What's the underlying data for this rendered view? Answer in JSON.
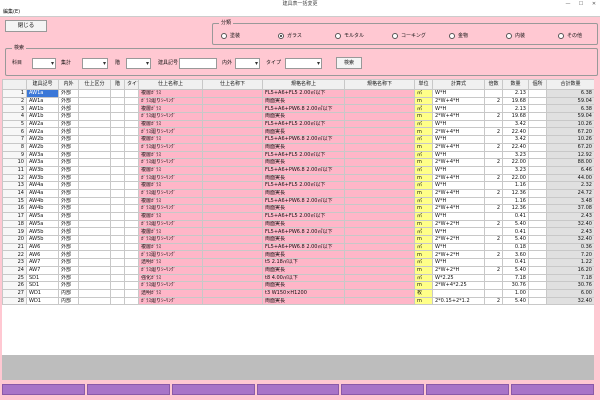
{
  "window": {
    "title": "建具表一括変更",
    "minimize": "—",
    "maximize": "☐",
    "close": "✕"
  },
  "menu": {
    "edit": "編集(E)"
  },
  "close_button": "閉じる",
  "category_group": {
    "title": "分類",
    "options": [
      "塗装",
      "ガラス",
      "モルタル",
      "コーキング",
      "金物",
      "内装",
      "その他"
    ],
    "selected": "ガラス"
  },
  "search_group": {
    "title": "検索",
    "labels": {
      "subject": "科目",
      "aggregate": "集計",
      "floor": "階",
      "fixture_no": "建具記号",
      "in_out": "内外",
      "type": "タイプ"
    },
    "search_button": "検索"
  },
  "table": {
    "headers": [
      "",
      "建具記号",
      "内外",
      "仕上区分",
      "階",
      "タイプ",
      "仕上名称上",
      "仕上名称下",
      "規格名称上",
      "規格名称下",
      "単位",
      "計算式",
      "倍数",
      "数量",
      "個所",
      "合計数量"
    ],
    "rows": [
      [
        "1",
        "AW1a",
        "外部",
        "",
        "",
        "",
        "複層ｶﾞﾗｽ",
        "",
        "FL5+A6+FL5 2.00㎡以下",
        "",
        "㎡",
        "W*H",
        "",
        "2.13",
        "",
        "6.38"
      ],
      [
        "2",
        "AW1a",
        "外部",
        "",
        "",
        "",
        "ｶﾞﾗｽ廻りｼｰﾘﾝｸﾞ",
        "",
        "両面実長",
        "",
        "m",
        "2*W+4*H",
        "2",
        "19.68",
        "",
        "59.04"
      ],
      [
        "3",
        "AW1b",
        "外部",
        "",
        "",
        "",
        "複層ｶﾞﾗｽ",
        "",
        "FL5+A6+PW6.8 2.00㎡以下",
        "",
        "㎡",
        "W*H",
        "",
        "2.13",
        "",
        "6.38"
      ],
      [
        "4",
        "AW1b",
        "外部",
        "",
        "",
        "",
        "ｶﾞﾗｽ廻りｼｰﾘﾝｸﾞ",
        "",
        "両面実長",
        "",
        "m",
        "2*W+4*H",
        "2",
        "19.68",
        "",
        "59.04"
      ],
      [
        "5",
        "AW2a",
        "外部",
        "",
        "",
        "",
        "複層ｶﾞﾗｽ",
        "",
        "FL5+A6+FL5 2.00㎡以下",
        "",
        "㎡",
        "W*H",
        "",
        "3.42",
        "",
        "10.26"
      ],
      [
        "6",
        "AW2a",
        "外部",
        "",
        "",
        "",
        "ｶﾞﾗｽ廻りｼｰﾘﾝｸﾞ",
        "",
        "両面実長",
        "",
        "m",
        "2*W+4*H",
        "2",
        "22.40",
        "",
        "67.20"
      ],
      [
        "7",
        "AW2b",
        "外部",
        "",
        "",
        "",
        "複層ｶﾞﾗｽ",
        "",
        "FL5+A6+PW6.8 2.00㎡以下",
        "",
        "㎡",
        "W*H",
        "",
        "3.42",
        "",
        "10.26"
      ],
      [
        "8",
        "AW2b",
        "外部",
        "",
        "",
        "",
        "ｶﾞﾗｽ廻りｼｰﾘﾝｸﾞ",
        "",
        "両面実長",
        "",
        "m",
        "2*W+4*H",
        "2",
        "22.40",
        "",
        "67.20"
      ],
      [
        "9",
        "AW3a",
        "外部",
        "",
        "",
        "",
        "複層ｶﾞﾗｽ",
        "",
        "FL5+A6+FL5 2.00㎡以下",
        "",
        "㎡",
        "W*H",
        "",
        "3.23",
        "",
        "12.92"
      ],
      [
        "10",
        "AW3a",
        "外部",
        "",
        "",
        "",
        "ｶﾞﾗｽ廻りｼｰﾘﾝｸﾞ",
        "",
        "両面実長",
        "",
        "m",
        "2*W+4*H",
        "2",
        "22.00",
        "",
        "88.00"
      ],
      [
        "11",
        "AW3b",
        "外部",
        "",
        "",
        "",
        "複層ｶﾞﾗｽ",
        "",
        "FL5+A6+PW6.8 2.00㎡以下",
        "",
        "㎡",
        "W*H",
        "",
        "3.23",
        "",
        "6.46"
      ],
      [
        "12",
        "AW3b",
        "外部",
        "",
        "",
        "",
        "ｶﾞﾗｽ廻りｼｰﾘﾝｸﾞ",
        "",
        "両面実長",
        "",
        "m",
        "2*W+4*H",
        "2",
        "22.00",
        "",
        "44.00"
      ],
      [
        "13",
        "AW4a",
        "外部",
        "",
        "",
        "",
        "複層ｶﾞﾗｽ",
        "",
        "FL5+A6+FL5 2.00㎡以下",
        "",
        "㎡",
        "W*H",
        "",
        "1.16",
        "",
        "2.32"
      ],
      [
        "14",
        "AW4a",
        "外部",
        "",
        "",
        "",
        "ｶﾞﾗｽ廻りｼｰﾘﾝｸﾞ",
        "",
        "両面実長",
        "",
        "m",
        "2*W+4*H",
        "2",
        "12.36",
        "",
        "24.72"
      ],
      [
        "15",
        "AW4b",
        "外部",
        "",
        "",
        "",
        "複層ｶﾞﾗｽ",
        "",
        "FL5+A6+PW6.8 2.00㎡以下",
        "",
        "㎡",
        "W*H",
        "",
        "1.16",
        "",
        "3.48"
      ],
      [
        "16",
        "AW4b",
        "外部",
        "",
        "",
        "",
        "ｶﾞﾗｽ廻りｼｰﾘﾝｸﾞ",
        "",
        "両面実長",
        "",
        "m",
        "2*W+4*H",
        "2",
        "12.36",
        "",
        "37.08"
      ],
      [
        "17",
        "AW5a",
        "外部",
        "",
        "",
        "",
        "複層ｶﾞﾗｽ",
        "",
        "FL5+A6+FL5 2.00㎡以下",
        "",
        "㎡",
        "W*H",
        "",
        "0.41",
        "",
        "2.43"
      ],
      [
        "18",
        "AW5a",
        "外部",
        "",
        "",
        "",
        "ｶﾞﾗｽ廻りｼｰﾘﾝｸﾞ",
        "",
        "両面実長",
        "",
        "m",
        "2*W+2*H",
        "2",
        "5.40",
        "",
        "32.40"
      ],
      [
        "19",
        "AW5b",
        "外部",
        "",
        "",
        "",
        "複層ｶﾞﾗｽ",
        "",
        "FL5+A6+PW6.8 2.00㎡以下",
        "",
        "㎡",
        "W*H",
        "",
        "0.41",
        "",
        "2.43"
      ],
      [
        "20",
        "AW5b",
        "外部",
        "",
        "",
        "",
        "ｶﾞﾗｽ廻りｼｰﾘﾝｸﾞ",
        "",
        "両面実長",
        "",
        "m",
        "2*W+2*H",
        "2",
        "5.40",
        "",
        "32.40"
      ],
      [
        "21",
        "AW6",
        "外部",
        "",
        "",
        "",
        "複層ｶﾞﾗｽ",
        "",
        "FL5+A6+PW6.8 2.00㎡以下",
        "",
        "㎡",
        "W*H",
        "",
        "0.18",
        "",
        "0.36"
      ],
      [
        "22",
        "AW6",
        "外部",
        "",
        "",
        "",
        "ｶﾞﾗｽ廻りｼｰﾘﾝｸﾞ",
        "",
        "両面実長",
        "",
        "m",
        "2*W+2*H",
        "2",
        "3.60",
        "",
        "7.20"
      ],
      [
        "23",
        "AW7",
        "外部",
        "",
        "",
        "",
        "透明ｶﾞﾗｽ",
        "",
        "t5 2.18㎡以下",
        "",
        "㎡",
        "W*H",
        "",
        "0.41",
        "",
        "1.22"
      ],
      [
        "24",
        "AW7",
        "外部",
        "",
        "",
        "",
        "ｶﾞﾗｽ廻りｼｰﾘﾝｸﾞ",
        "",
        "両面実長",
        "",
        "m",
        "2*W+2*H",
        "2",
        "5.40",
        "",
        "16.20"
      ],
      [
        "25",
        "SD1",
        "外部",
        "",
        "",
        "",
        "強化ｶﾞﾗｽ",
        "",
        "t8 4.00㎡以下",
        "",
        "㎡",
        "W*2.25",
        "",
        "7.18",
        "",
        "7.18"
      ],
      [
        "26",
        "SD1",
        "外部",
        "",
        "",
        "",
        "ｶﾞﾗｽ廻りｼｰﾘﾝｸﾞ",
        "",
        "両面実長",
        "",
        "m",
        "2*W+4*2.25",
        "",
        "30.76",
        "",
        "30.76"
      ],
      [
        "27",
        "WD1",
        "内部",
        "",
        "",
        "",
        "透明ｶﾞﾗｽ",
        "",
        "t3 W150×H1200",
        "",
        "枚",
        "",
        "",
        "1.00",
        "",
        "6.00"
      ],
      [
        "28",
        "WD1",
        "内部",
        "",
        "",
        "",
        "ｶﾞﾗｽ廻りｼｰﾘﾝｸﾞ",
        "",
        "両面実長",
        "",
        "m",
        "2*0.15+2*1.2",
        "2",
        "5.40",
        "",
        "32.40"
      ]
    ]
  }
}
